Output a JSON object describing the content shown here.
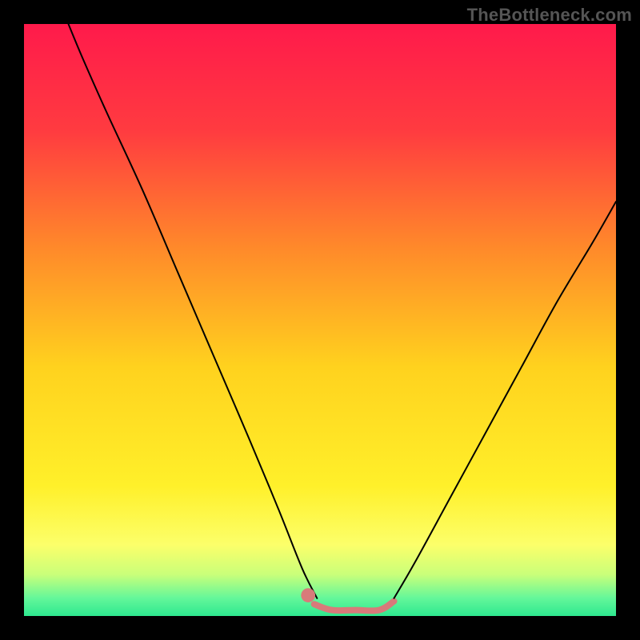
{
  "watermark": "TheBottleneck.com",
  "chart_data": {
    "type": "line",
    "title": "",
    "xlabel": "",
    "ylabel": "",
    "xlim": [
      0,
      100
    ],
    "ylim": [
      0,
      100
    ],
    "background_gradient": {
      "stops": [
        {
          "pos": 0.0,
          "color": "#ff1a4b"
        },
        {
          "pos": 0.18,
          "color": "#ff3b40"
        },
        {
          "pos": 0.38,
          "color": "#ff8a2a"
        },
        {
          "pos": 0.58,
          "color": "#ffd21e"
        },
        {
          "pos": 0.78,
          "color": "#fff02a"
        },
        {
          "pos": 0.88,
          "color": "#fcff6a"
        },
        {
          "pos": 0.93,
          "color": "#c9ff7a"
        },
        {
          "pos": 0.97,
          "color": "#63f79a"
        },
        {
          "pos": 1.0,
          "color": "#2ee88f"
        }
      ]
    },
    "series": [
      {
        "name": "left-branch",
        "color": "#000000",
        "width": 2.0,
        "points": [
          {
            "x": 7.5,
            "y": 100.0
          },
          {
            "x": 10.0,
            "y": 94.0
          },
          {
            "x": 14.0,
            "y": 85.0
          },
          {
            "x": 20.0,
            "y": 72.0
          },
          {
            "x": 26.0,
            "y": 58.0
          },
          {
            "x": 32.0,
            "y": 44.0
          },
          {
            "x": 38.0,
            "y": 30.0
          },
          {
            "x": 43.0,
            "y": 18.0
          },
          {
            "x": 47.0,
            "y": 8.0
          },
          {
            "x": 49.5,
            "y": 3.0
          }
        ]
      },
      {
        "name": "valley-floor",
        "color": "#d87a7a",
        "width": 8.0,
        "points": [
          {
            "x": 49.0,
            "y": 2.0
          },
          {
            "x": 52.0,
            "y": 1.0
          },
          {
            "x": 56.0,
            "y": 1.0
          },
          {
            "x": 60.0,
            "y": 1.0
          },
          {
            "x": 62.5,
            "y": 2.5
          }
        ]
      },
      {
        "name": "right-branch",
        "color": "#000000",
        "width": 2.0,
        "points": [
          {
            "x": 62.5,
            "y": 3.0
          },
          {
            "x": 66.0,
            "y": 9.0
          },
          {
            "x": 72.0,
            "y": 20.0
          },
          {
            "x": 78.0,
            "y": 31.0
          },
          {
            "x": 84.0,
            "y": 42.0
          },
          {
            "x": 90.0,
            "y": 53.0
          },
          {
            "x": 96.0,
            "y": 63.0
          },
          {
            "x": 100.0,
            "y": 70.0
          }
        ]
      }
    ],
    "markers": [
      {
        "x": 48.0,
        "y": 3.5,
        "r": 1.2,
        "color": "#d87a7a"
      }
    ]
  }
}
